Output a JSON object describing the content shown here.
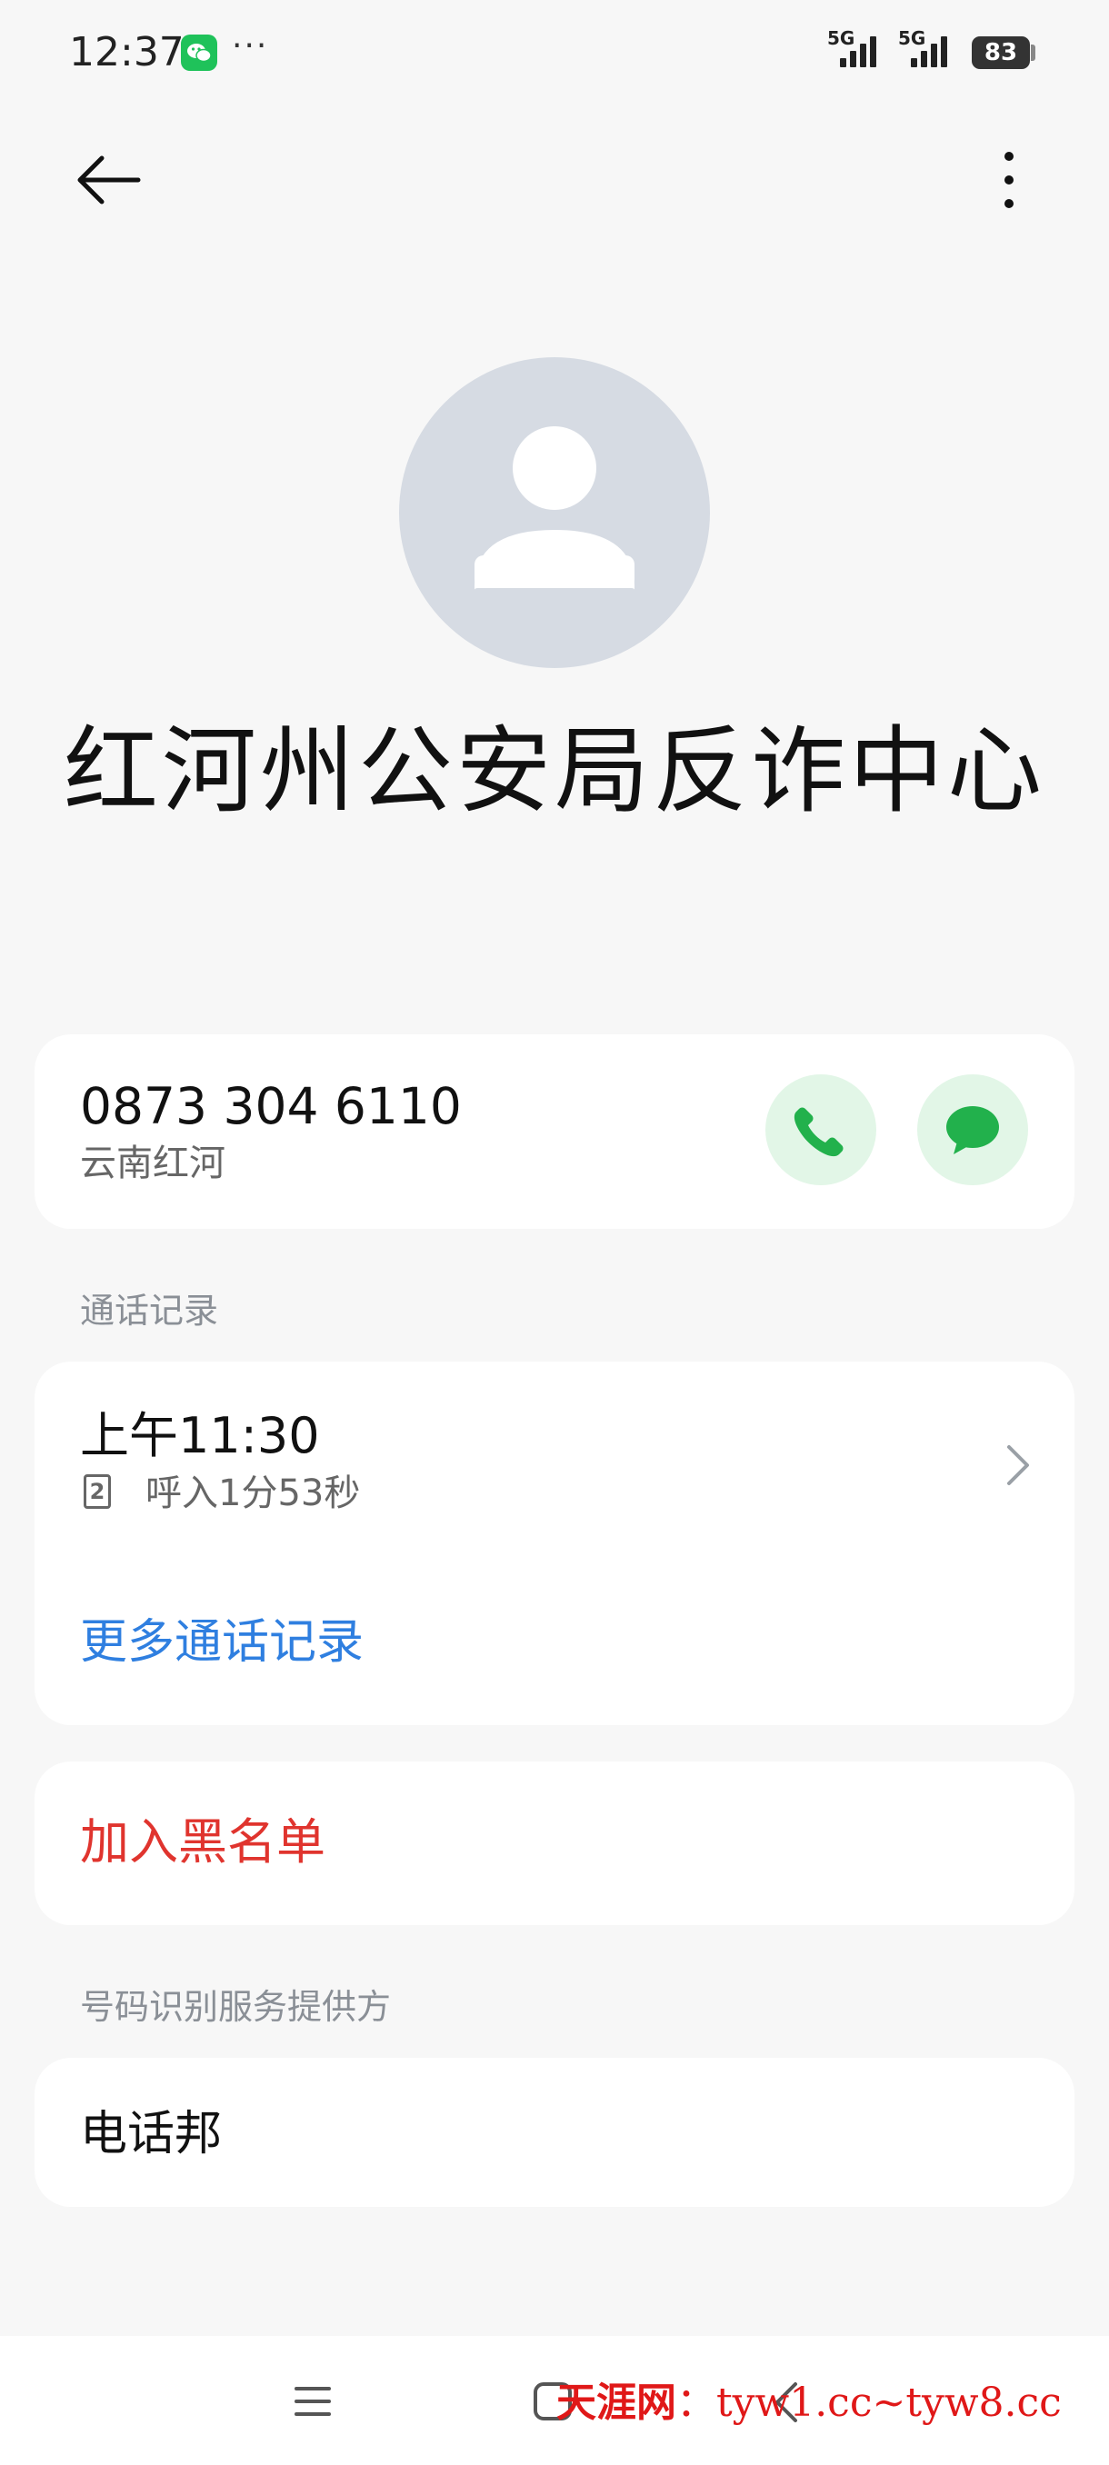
{
  "status_bar": {
    "time": "12:37",
    "notification_icons": [
      "wechat-icon"
    ],
    "overflow": "···",
    "network_labels": [
      "5G",
      "5G"
    ],
    "battery": "83"
  },
  "app_bar": {
    "back_icon": "arrow-left-icon",
    "more_icon": "more-vertical-icon"
  },
  "contact": {
    "name": "红河州公安局反诈中心",
    "avatar_icon": "person-placeholder-icon",
    "avatar_color": "#d6dbe3"
  },
  "phone": {
    "number": "0873 304 6110",
    "location": "云南红河",
    "call_icon": "phone-icon",
    "message_icon": "chat-bubble-icon",
    "action_color": "#22b14c"
  },
  "call_log": {
    "section_label": "通话记录",
    "entries": [
      {
        "time": "上午11:30",
        "sim": "2",
        "detail": "呼入1分53秒"
      }
    ],
    "more_label": "更多通话记录",
    "link_color": "#2f7fe0"
  },
  "block": {
    "label": "加入黑名单",
    "color": "#e0342e"
  },
  "provider": {
    "section_label": "号码识别服务提供方",
    "name": "电话邦"
  },
  "navigation": {
    "menu_icon": "menu-icon",
    "home_icon": "home-square-icon",
    "back_icon": "back-chevron-icon"
  },
  "watermark": {
    "site": "天涯网",
    "separator": "：",
    "urls": "tyw1.cc~tyw8.cc"
  }
}
